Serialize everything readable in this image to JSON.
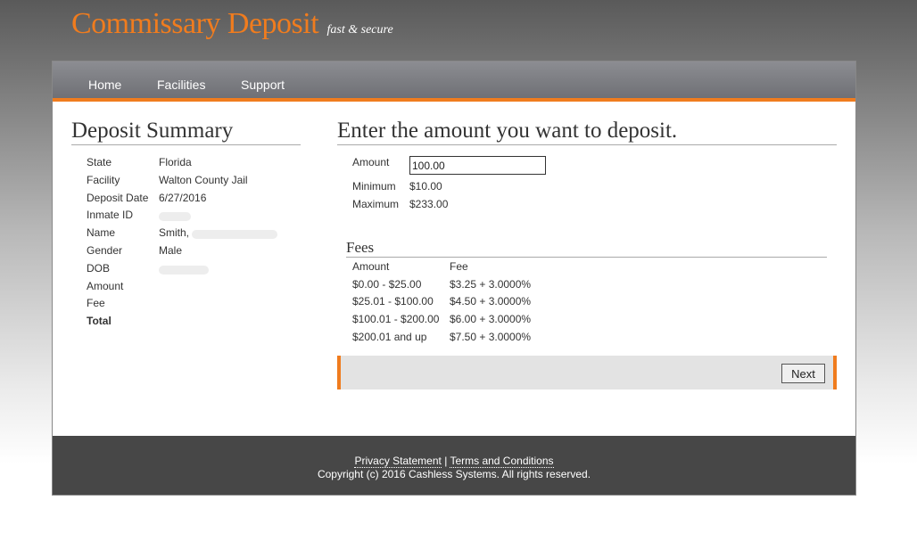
{
  "brand": {
    "title": "Commissary Deposit",
    "tagline": "fast & secure"
  },
  "nav": {
    "items": [
      {
        "label": "Home"
      },
      {
        "label": "Facilities"
      },
      {
        "label": "Support"
      }
    ]
  },
  "summary": {
    "title": "Deposit Summary",
    "rows": [
      {
        "label": "State",
        "value": "Florida"
      },
      {
        "label": "Facility",
        "value": "Walton County Jail"
      },
      {
        "label": "Deposit Date",
        "value": "6/27/2016"
      },
      {
        "label": "Inmate ID",
        "value": ""
      },
      {
        "label": "Name",
        "value": "Smith,"
      },
      {
        "label": "Gender",
        "value": "Male"
      },
      {
        "label": "DOB",
        "value": ""
      },
      {
        "label": "Amount",
        "value": ""
      },
      {
        "label": "Fee",
        "value": ""
      },
      {
        "label": "Total",
        "value": ""
      }
    ]
  },
  "deposit": {
    "title": "Enter the amount you want to deposit.",
    "amount_label": "Amount",
    "amount_value": "100.00",
    "minimum_label": "Minimum",
    "minimum_value": "$10.00",
    "maximum_label": "Maximum",
    "maximum_value": "$233.00"
  },
  "fees": {
    "title": "Fees",
    "header_amount": "Amount",
    "header_fee": "Fee",
    "rows": [
      {
        "amount": "$0.00 - $25.00",
        "fee": "$3.25 + 3.0000%"
      },
      {
        "amount": "$25.01 - $100.00",
        "fee": "$4.50 + 3.0000%"
      },
      {
        "amount": "$100.01 - $200.00",
        "fee": "$6.00 + 3.0000%"
      },
      {
        "amount": "$200.01 and up",
        "fee": "$7.50 + 3.0000%"
      }
    ]
  },
  "actions": {
    "next_label": "Next"
  },
  "footer": {
    "privacy": "Privacy Statement",
    "separator": "|",
    "terms": "Terms and Conditions",
    "copyright": "Copyright (c) 2016 Cashless Systems. All rights reserved."
  },
  "colors": {
    "accent": "#f07c1e",
    "nav_bg": "#7a7b80",
    "footer_bg": "#474747"
  }
}
